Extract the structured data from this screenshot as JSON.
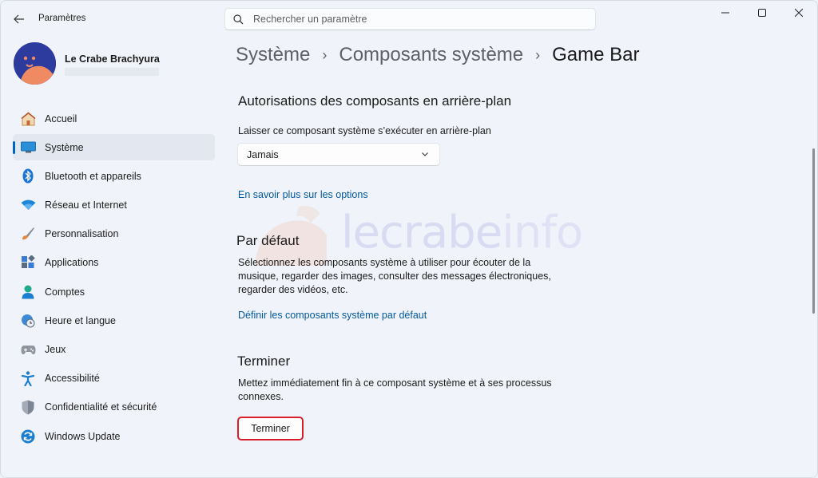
{
  "window": {
    "app_title": "Paramètres",
    "back_icon": "arrow-left-icon",
    "controls": [
      "minimize-icon",
      "maximize-icon",
      "close-icon"
    ]
  },
  "search": {
    "placeholder": "Rechercher un paramètre",
    "value": ""
  },
  "profile": {
    "name": "Le Crabe Brachyura"
  },
  "sidebar": {
    "items": [
      {
        "label": "Accueil",
        "icon": "home-icon",
        "active": false
      },
      {
        "label": "Système",
        "icon": "monitor-icon",
        "active": true
      },
      {
        "label": "Bluetooth et appareils",
        "icon": "bluetooth-icon",
        "active": false
      },
      {
        "label": "Réseau et Internet",
        "icon": "wifi-icon",
        "active": false
      },
      {
        "label": "Personnalisation",
        "icon": "brush-icon",
        "active": false
      },
      {
        "label": "Applications",
        "icon": "apps-icon",
        "active": false
      },
      {
        "label": "Comptes",
        "icon": "account-icon",
        "active": false
      },
      {
        "label": "Heure et langue",
        "icon": "clock-globe-icon",
        "active": false
      },
      {
        "label": "Jeux",
        "icon": "gamepad-icon",
        "active": false
      },
      {
        "label": "Accessibilité",
        "icon": "accessibility-icon",
        "active": false
      },
      {
        "label": "Confidentialité et sécurité",
        "icon": "shield-icon",
        "active": false
      },
      {
        "label": "Windows Update",
        "icon": "update-icon",
        "active": false
      }
    ]
  },
  "breadcrumb": {
    "items": [
      "Système",
      "Composants système",
      "Game Bar"
    ]
  },
  "background_permissions": {
    "title": "Autorisations des composants en arrière-plan",
    "label": "Laisser ce composant système s’exécuter en arrière-plan",
    "selected": "Jamais",
    "link": "En savoir plus sur les options"
  },
  "defaults": {
    "title": "Par défaut",
    "description_lines": [
      "Sélectionnez les composants système à utiliser pour écouter de la",
      "musique, regarder des images, consulter des messages électroniques,",
      "regarder des vidéos, etc."
    ],
    "link": "Définir les composants système par défaut"
  },
  "terminate": {
    "title": "Terminer",
    "description_lines": [
      "Mettez immédiatement fin à ce composant système et à ses processus",
      "connexes."
    ],
    "button": "Terminer",
    "highlight_color": "#d9202a"
  },
  "watermark": {
    "text_main": "lecrabe",
    "text_alt": "info"
  },
  "colors": {
    "accent": "#0067c0",
    "link": "#00589f",
    "background": "#f0f3f9"
  }
}
